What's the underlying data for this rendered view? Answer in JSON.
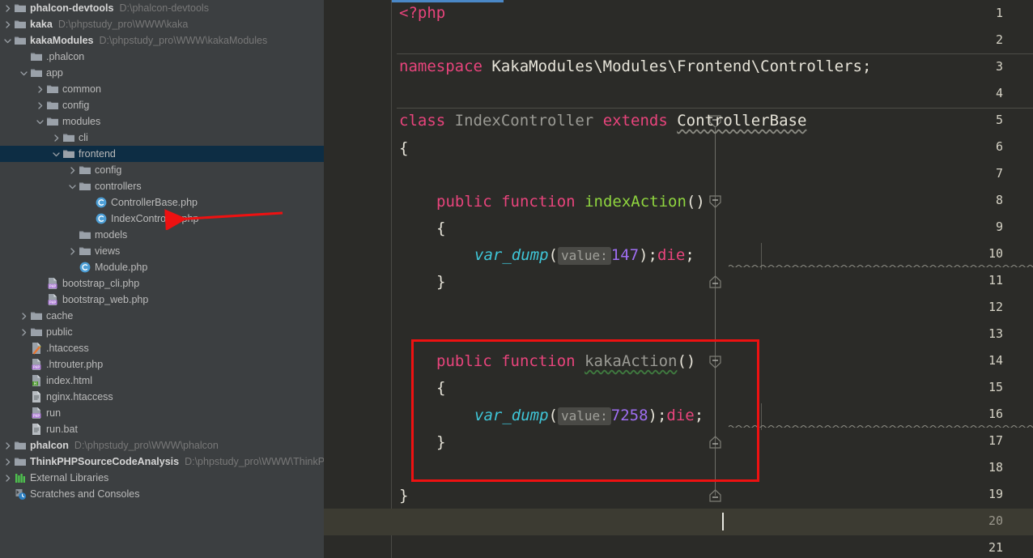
{
  "project_pane": {
    "name": "Project tool window",
    "rows": [
      {
        "indent": 0,
        "arrow": "right",
        "icon": "folder",
        "label": "phalcon-devtools",
        "bold": true,
        "path": "D:\\phalcon-devtools",
        "selected": false
      },
      {
        "indent": 0,
        "arrow": "right",
        "icon": "folder",
        "label": "kaka",
        "bold": true,
        "path": "D:\\phpstudy_pro\\WWW\\kaka",
        "selected": false
      },
      {
        "indent": 0,
        "arrow": "down",
        "icon": "folder",
        "label": "kakaModules",
        "bold": true,
        "path": "D:\\phpstudy_pro\\WWW\\kakaModules",
        "selected": false
      },
      {
        "indent": 1,
        "arrow": "none",
        "icon": "folder",
        "label": ".phalcon",
        "bold": false,
        "path": "",
        "selected": false
      },
      {
        "indent": 1,
        "arrow": "down",
        "icon": "folder",
        "label": "app",
        "bold": false,
        "path": "",
        "selected": false
      },
      {
        "indent": 2,
        "arrow": "right",
        "icon": "folder",
        "label": "common",
        "bold": false,
        "path": "",
        "selected": false
      },
      {
        "indent": 2,
        "arrow": "right",
        "icon": "folder",
        "label": "config",
        "bold": false,
        "path": "",
        "selected": false
      },
      {
        "indent": 2,
        "arrow": "down",
        "icon": "folder",
        "label": "modules",
        "bold": false,
        "path": "",
        "selected": false
      },
      {
        "indent": 3,
        "arrow": "right",
        "icon": "folder",
        "label": "cli",
        "bold": false,
        "path": "",
        "selected": false
      },
      {
        "indent": 3,
        "arrow": "down",
        "icon": "folder",
        "label": "frontend",
        "bold": false,
        "path": "",
        "selected": true
      },
      {
        "indent": 4,
        "arrow": "right",
        "icon": "folder",
        "label": "config",
        "bold": false,
        "path": "",
        "selected": false
      },
      {
        "indent": 4,
        "arrow": "down",
        "icon": "folder",
        "label": "controllers",
        "bold": false,
        "path": "",
        "selected": false
      },
      {
        "indent": 5,
        "arrow": "none",
        "icon": "php-class",
        "label": "ControllerBase.php",
        "bold": false,
        "path": "",
        "selected": false
      },
      {
        "indent": 5,
        "arrow": "none",
        "icon": "php-class",
        "label": "IndexController.php",
        "bold": false,
        "path": "",
        "selected": false
      },
      {
        "indent": 4,
        "arrow": "none",
        "icon": "folder",
        "label": "models",
        "bold": false,
        "path": "",
        "selected": false
      },
      {
        "indent": 4,
        "arrow": "right",
        "icon": "folder",
        "label": "views",
        "bold": false,
        "path": "",
        "selected": false
      },
      {
        "indent": 4,
        "arrow": "none",
        "icon": "php-class",
        "label": "Module.php",
        "bold": false,
        "path": "",
        "selected": false
      },
      {
        "indent": 2,
        "arrow": "none",
        "icon": "php-file",
        "label": "bootstrap_cli.php",
        "bold": false,
        "path": "",
        "selected": false
      },
      {
        "indent": 2,
        "arrow": "none",
        "icon": "php-file",
        "label": "bootstrap_web.php",
        "bold": false,
        "path": "",
        "selected": false
      },
      {
        "indent": 1,
        "arrow": "right",
        "icon": "folder",
        "label": "cache",
        "bold": false,
        "path": "",
        "selected": false
      },
      {
        "indent": 1,
        "arrow": "right",
        "icon": "folder",
        "label": "public",
        "bold": false,
        "path": "",
        "selected": false
      },
      {
        "indent": 1,
        "arrow": "none",
        "icon": "htaccess",
        "label": ".htaccess",
        "bold": false,
        "path": "",
        "selected": false
      },
      {
        "indent": 1,
        "arrow": "none",
        "icon": "php-file",
        "label": ".htrouter.php",
        "bold": false,
        "path": "",
        "selected": false
      },
      {
        "indent": 1,
        "arrow": "none",
        "icon": "html-file",
        "label": "index.html",
        "bold": false,
        "path": "",
        "selected": false
      },
      {
        "indent": 1,
        "arrow": "none",
        "icon": "text-file",
        "label": "nginx.htaccess",
        "bold": false,
        "path": "",
        "selected": false
      },
      {
        "indent": 1,
        "arrow": "none",
        "icon": "php-file",
        "label": "run",
        "bold": false,
        "path": "",
        "selected": false
      },
      {
        "indent": 1,
        "arrow": "none",
        "icon": "text-file",
        "label": "run.bat",
        "bold": false,
        "path": "",
        "selected": false
      },
      {
        "indent": 0,
        "arrow": "right",
        "icon": "folder",
        "label": "phalcon",
        "bold": true,
        "path": "D:\\phpstudy_pro\\WWW\\phalcon",
        "selected": false
      },
      {
        "indent": 0,
        "arrow": "right",
        "icon": "folder",
        "label": "ThinkPHPSourceCodeAnalysis",
        "bold": true,
        "path": "D:\\phpstudy_pro\\WWW\\ThinkP",
        "selected": false
      },
      {
        "indent": 0,
        "arrow": "right",
        "icon": "libraries",
        "label": "External Libraries",
        "bold": false,
        "path": "",
        "selected": false
      },
      {
        "indent": 0,
        "arrow": "none",
        "icon": "scratches",
        "label": "Scratches and Consoles",
        "bold": false,
        "path": "",
        "selected": false
      }
    ]
  },
  "editor": {
    "name": "IndexController.php editor",
    "line_numbers": [
      "1",
      "2",
      "3",
      "4",
      "5",
      "6",
      "7",
      "8",
      "9",
      "10",
      "11",
      "12",
      "13",
      "14",
      "15",
      "16",
      "17",
      "18",
      "19",
      "20",
      "21"
    ],
    "current_line": 20,
    "lines": {
      "l1_php_open": "<?php",
      "l3_kw_namespace": "namespace",
      "l3_ns": "KakaModules\\Modules\\Frontend\\Controllers",
      "l3_semi": ";",
      "l5_kw_class": "class",
      "l5_classname": "IndexController",
      "l5_kw_extends": "extends",
      "l5_base": "ControllerBase",
      "l6_brace": "{",
      "l8_kw_public": "public",
      "l8_kw_function": "function",
      "l8_method": "indexAction",
      "l8_parens": "()",
      "l9_brace": "{",
      "l10_call": "var_dump",
      "l10_open": "(",
      "l10_hint": "value:",
      "l10_value": "147",
      "l10_tail": ");",
      "l10_die": "die",
      "l10_semi": ";",
      "l11_brace": "}",
      "l14_kw_public": "public",
      "l14_kw_function": "function",
      "l14_method": "kakaAction",
      "l14_parens": "()",
      "l15_brace": "{",
      "l16_call": "var_dump",
      "l16_open": "(",
      "l16_hint": "value:",
      "l16_value": "7258",
      "l16_tail": ");",
      "l16_die": "die",
      "l16_semi": ";",
      "l17_brace": "}",
      "l19_brace": "}"
    }
  },
  "annotations": {
    "name": "red markup overlay",
    "highlight_box_label": "kakaAction method highlight",
    "arrow_label": "arrow pointing at IndexController.php"
  },
  "colors": {
    "editor_bg": "#2b2b28",
    "sidebar_bg": "#3c3f41",
    "selection_blue": "#0d2d44",
    "current_line": "#3c3b32",
    "keyword": "#e8447c",
    "method_name": "#8fd53f",
    "function_call": "#3fc6d8",
    "number": "#9f6ef2",
    "annotation_red": "#ee1111",
    "tab_underline": "#4a88c7"
  }
}
